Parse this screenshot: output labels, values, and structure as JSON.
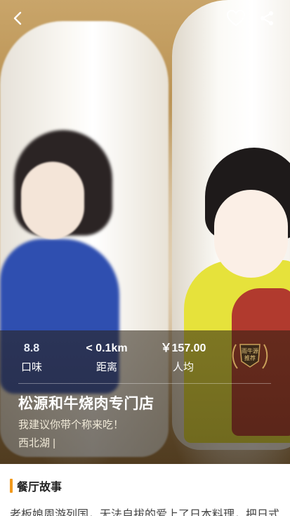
{
  "topbar": {
    "back_icon": "chevron-left-icon",
    "favorite_icon": "heart-outline-icon",
    "share_icon": "share-icon"
  },
  "stats": [
    {
      "value": "8.8",
      "label": "口味"
    },
    {
      "value": "< 0.1km",
      "label": "距离"
    },
    {
      "value": "￥157.00",
      "label": "人均"
    }
  ],
  "badge": {
    "text_line1": "雨牛源",
    "text_line2": "推荐"
  },
  "restaurant": {
    "name": "松源和牛烧肉专门店",
    "slogan": "我建议你带个称来吃！",
    "location": "西北湖 |"
  },
  "section": {
    "title": "餐厅故事"
  },
  "story": {
    "text": "老板娘周游列国，无法自拔的爱上了日本料理，把日式"
  },
  "colors": {
    "accent": "#f29a1d",
    "stat_label": "#ffffff"
  }
}
